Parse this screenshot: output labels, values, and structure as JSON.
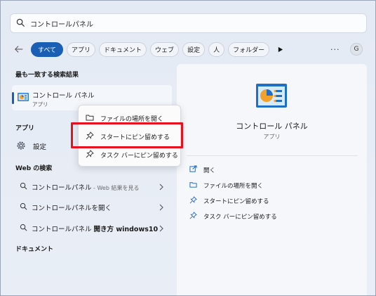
{
  "search": {
    "value": "コントロールパネル",
    "icon": "search-icon"
  },
  "filters": {
    "back_icon": "back-arrow-icon",
    "chips": [
      "すべて",
      "アプリ",
      "ドキュメント",
      "ウェブ",
      "設定",
      "人",
      "フォルダー"
    ],
    "more_label": "···",
    "avatar_letter": "G"
  },
  "left": {
    "best_match_heading": "最も一致する検索結果",
    "best_match": {
      "name": "コントロール パネル",
      "type": "アプリ"
    },
    "apps_heading": "アプリ",
    "settings_label": "設定",
    "web_heading": "Web の検索",
    "web_results": [
      {
        "main": "コントロールパネル",
        "extra": " - Web 結果を見る"
      },
      {
        "main": "コントロールパネルを開く",
        "extra": ""
      },
      {
        "main": "コントロールパネル ",
        "extra": "開き方 windows10"
      }
    ],
    "documents_heading": "ドキュメント"
  },
  "right": {
    "title": "コントロール パネル",
    "subtitle": "アプリ",
    "actions": [
      "開く",
      "ファイルの場所を開く",
      "スタートにピン留めする",
      "タスク バーにピン留めする"
    ]
  },
  "context_menu": {
    "items": [
      "ファイルの場所を開く",
      "スタートにピン留めする",
      "タスク バーにピン留めする"
    ]
  },
  "colors": {
    "accent": "#1a5fb4",
    "highlight": "#e8101e"
  }
}
